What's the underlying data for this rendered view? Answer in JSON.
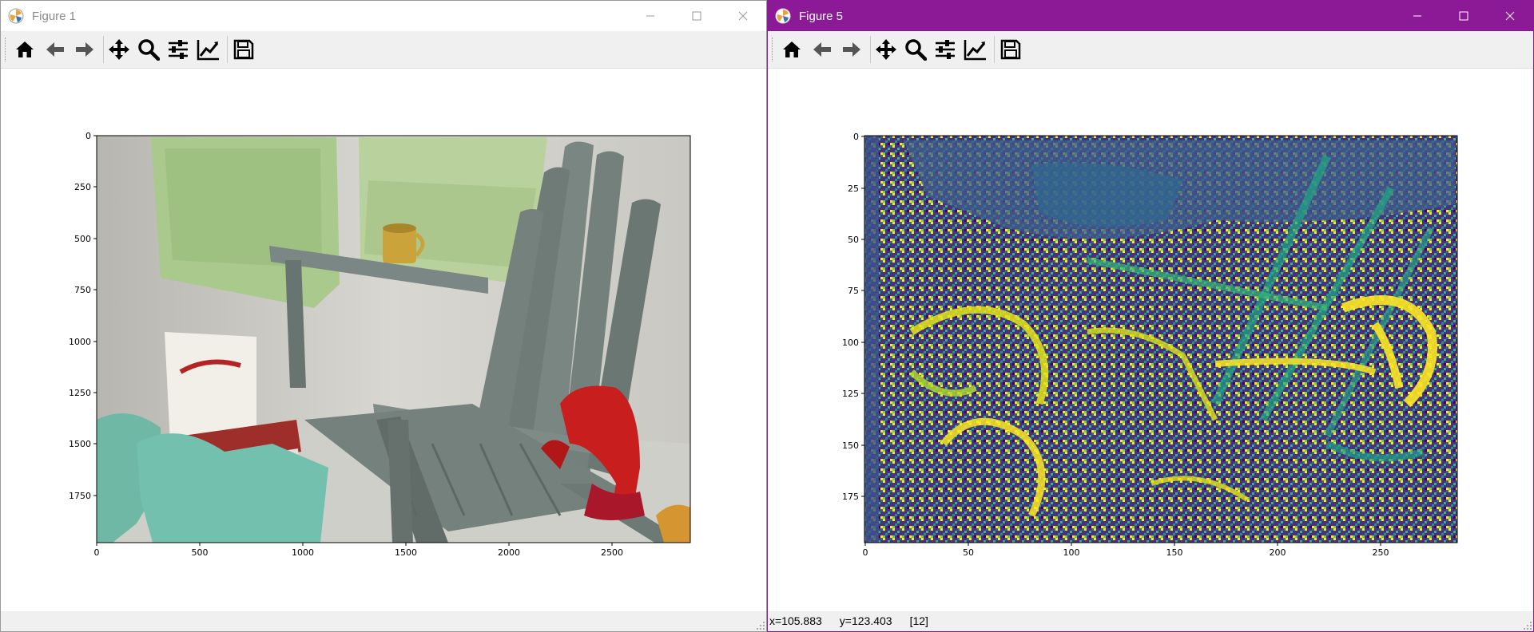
{
  "windows": [
    {
      "title": "Figure 1",
      "toolbar": [
        "home-icon",
        "back-arrow-icon",
        "forward-arrow-icon",
        "pan-move-icon",
        "zoom-magnifier-icon",
        "configure-subplots-icon",
        "edit-axis-icon",
        "save-floppy-icon"
      ],
      "plot": {
        "image": "photograph of a grey wooden adirondack chair with a yellow mug, red scarf, stacked books and teal cloth in front of campus maps",
        "xticks": [
          "0",
          "500",
          "1000",
          "1500",
          "2000",
          "2500"
        ],
        "yticks": [
          "0",
          "250",
          "500",
          "750",
          "1000",
          "1250",
          "1500",
          "1750"
        ],
        "xlim": [
          0,
          2880
        ],
        "ylim": [
          1980,
          0
        ]
      }
    },
    {
      "title": "Figure 5",
      "accent": "#8c1a96",
      "toolbar": [
        "home-icon",
        "back-arrow-icon",
        "forward-arrow-icon",
        "pan-move-icon",
        "zoom-magnifier-icon",
        "configure-subplots-icon",
        "edit-axis-icon",
        "save-floppy-icon"
      ],
      "plot": {
        "image": "noisy viridis-colormap image of the same chair scene at 288x198 resolution",
        "xticks": [
          "0",
          "50",
          "100",
          "150",
          "200",
          "250"
        ],
        "yticks": [
          "0",
          "25",
          "50",
          "75",
          "100",
          "125",
          "150",
          "175"
        ],
        "xlim": [
          0,
          288
        ],
        "ylim": [
          198,
          0
        ]
      },
      "status": {
        "x": "x=105.883",
        "y": "y=123.403",
        "value": "[12]"
      }
    }
  ]
}
